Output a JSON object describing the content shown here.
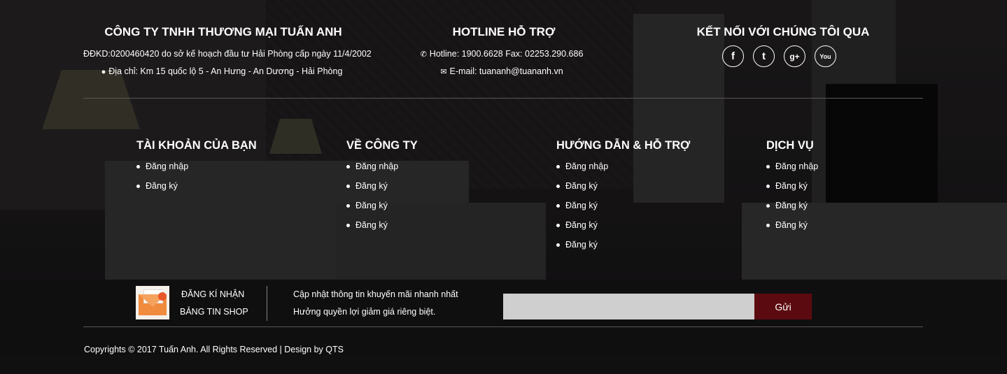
{
  "company": {
    "title": "CÔNG TY TNHH THƯƠNG MẠI TUẤN ANH",
    "registration": "ĐĐKD:0200460420 do sở kế hoạch đầu tư Hải Phòng cấp ngày 11/4/2002",
    "address": "Địa chỉ: Km 15 quốc lộ 5 - An Hưng - An Dương - Hải Phòng"
  },
  "hotline": {
    "title": "HOTLINE HỖ TRỢ",
    "phone": "Hotline: 1900.6628 Fax: 02253.290.686",
    "email": "E-mail: tuananh@tuananh.vn"
  },
  "social": {
    "title": "KẾT NỐI VỚI CHÚNG TÔI QUA",
    "icons": [
      "facebook-icon",
      "twitter-icon",
      "google-plus-icon",
      "youtube-icon"
    ]
  },
  "menus": [
    {
      "title": "TÀI KHOẢN CỦA BẠN",
      "items": [
        "Đăng nhập",
        "Đăng ký"
      ]
    },
    {
      "title": "VỀ CÔNG TY",
      "items": [
        "Đăng nhập",
        "Đăng ký",
        "Đăng ký",
        "Đăng ký"
      ]
    },
    {
      "title": "HƯỚNG DẪN & HỖ TRỢ",
      "items": [
        "Đăng nhập",
        "Đăng ký",
        "Đăng ký",
        "Đăng ký",
        "Đăng ký"
      ]
    },
    {
      "title": "DỊCH VỤ",
      "items": [
        "Đăng nhập",
        "Đăng ký",
        "Đăng ký",
        "Đăng ký"
      ]
    }
  ],
  "newsletter": {
    "label_line1": "ĐĂNG KÍ NHẬN",
    "label_line2": "BẢNG TIN SHOP",
    "desc_line1": "Cập nhật thông tin khuyến mãi nhanh nhất",
    "desc_line2": "Hưởng quyền lợi giảm giá riêng biệt.",
    "input_value": "",
    "button": "Gửi",
    "button_color": "#5b0b10"
  },
  "copyright": "Copyrights © 2017 Tuấn Anh. All Rights Reserved | Design by QTS"
}
